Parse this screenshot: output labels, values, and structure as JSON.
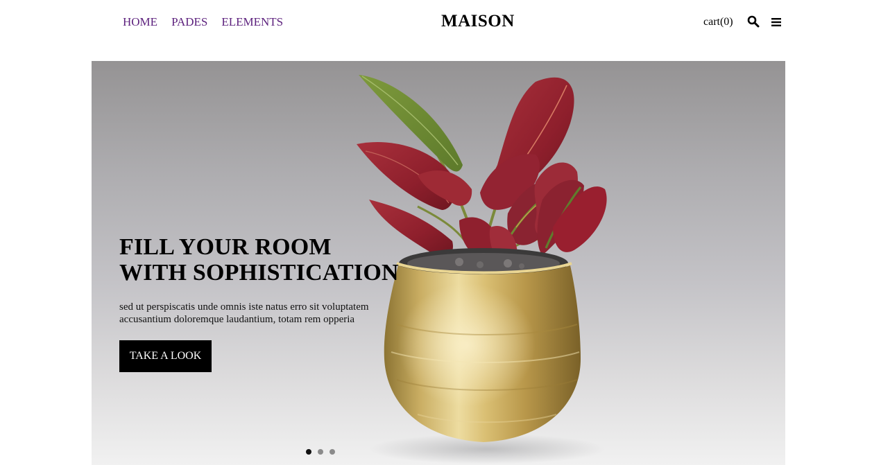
{
  "nav": {
    "items": [
      {
        "label": "HOME"
      },
      {
        "label": "PADES"
      },
      {
        "label": "ELEMENTS"
      }
    ]
  },
  "brand": {
    "logo": "MAISON"
  },
  "header_actions": {
    "cart_label": "cart(0)",
    "search_icon": "search-icon",
    "menu_icon": "hamburger-menu-icon"
  },
  "hero": {
    "title_line1": "FILL YOUR ROOM",
    "title_line2": "WITH SOPHISTICATION",
    "text_line1": "sed ut perspiscatis unde omnis iste natus erro sit voluptatem",
    "text_line2": "accusantium doloremque laudantium, totam rem opperia",
    "cta_label": "TAKE A LOOK",
    "slides_total": 3,
    "active_slide": 1
  },
  "colors": {
    "nav_link": "#5b1f7c",
    "cta_bg": "#000000",
    "cta_text": "#ffffff",
    "dot_active": "#111111",
    "dot_inactive": "#8b8b8b"
  }
}
